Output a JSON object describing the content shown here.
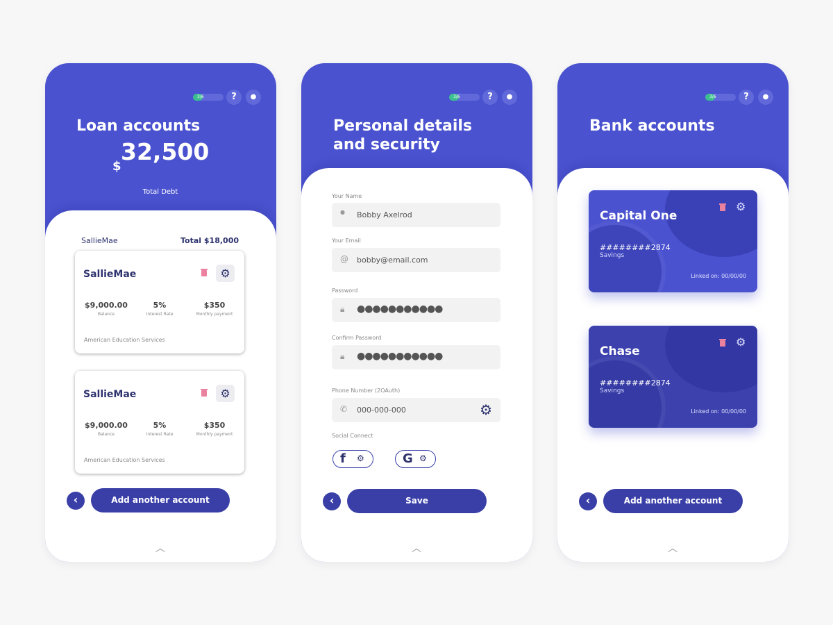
{
  "colors": {
    "primary": "#4a52cf",
    "dark": "#3a3fa8",
    "progress": "#3bbf8f",
    "trash": "#e9819f"
  },
  "header": {
    "progress_label": "3/6",
    "progress_value": 0.5,
    "help_icon": "question-icon",
    "chat_icon": "chat-bubble-icon"
  },
  "loan": {
    "title": "Loan accounts",
    "currency": "$",
    "amount": "32,500",
    "subtitle": "Total Debt",
    "group_name": "SallieMae",
    "group_total": "Total $18,000",
    "cards": [
      {
        "name": "SallieMae",
        "balance": "$9,000.00",
        "balance_label": "Balance",
        "rate": "5%",
        "rate_label": "Interest Rate",
        "payment": "$350",
        "payment_label": "Monthly payment",
        "provider": "American Education Services"
      },
      {
        "name": "SallieMae",
        "balance": "$9,000.00",
        "balance_label": "Balance",
        "rate": "5%",
        "rate_label": "Interest Rate",
        "payment": "$350",
        "payment_label": "Monthly payment",
        "provider": "American Education Services"
      }
    ],
    "button": "Add another account"
  },
  "personal": {
    "title_line1": "Personal details",
    "title_line2": "and security",
    "name_label": "Your Name",
    "name_value": "Bobby Axelrod",
    "email_label": "Your Email",
    "email_value": "bobby@email.com",
    "password_label": "Password",
    "password_value": "●●●●●●●●●●●",
    "confirm_label": "Confirm Password",
    "confirm_value": "●●●●●●●●●●●",
    "phone_label": "Phone Number (2OAuth)",
    "phone_value": "000-000-000",
    "social_label": "Social Connect",
    "facebook": "f",
    "google": "G",
    "button": "Save"
  },
  "bank": {
    "title": "Bank accounts",
    "cards": [
      {
        "name": "Capital One",
        "number": "########2874",
        "type": "Savings",
        "linked": "Linked on: 00/00/00"
      },
      {
        "name": "Chase",
        "number": "########2874",
        "type": "Savings",
        "linked": "Linked on: 00/00/00"
      }
    ],
    "button": "Add another account"
  }
}
